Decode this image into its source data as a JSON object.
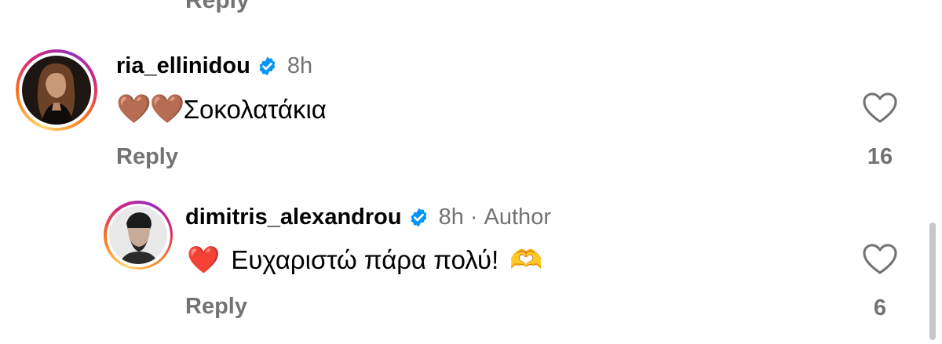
{
  "top": {
    "reply_label": "Reply"
  },
  "comments": [
    {
      "username": "ria_ellinidou",
      "time": "8h",
      "text": "Σοκολατάκια",
      "emoji": "🤎🤎",
      "reply_label": "Reply",
      "likes": "16"
    },
    {
      "username": "dimitris_alexandrou",
      "time": "8h",
      "separator": "·",
      "author_badge": "Author",
      "text": "Ευχαριστώ πάρα πολύ!",
      "emoji_before": "❤️",
      "emoji_after": "🫶",
      "reply_label": "Reply",
      "likes": "6"
    }
  ],
  "colors": {
    "verified": "#0095f6",
    "secondary_text": "#737373",
    "heart_red": "#e8132b",
    "brown_heart": "#8a5a33"
  },
  "icons": [
    "verified-badge-icon",
    "heart-outline-icon"
  ]
}
